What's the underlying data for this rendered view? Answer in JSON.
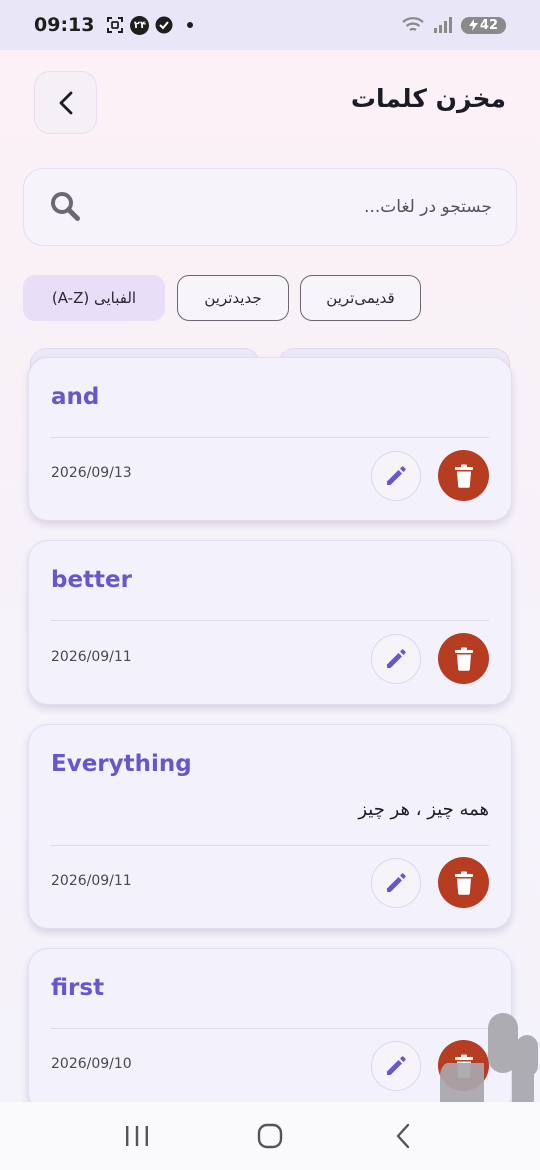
{
  "status_bar": {
    "time": "09:13",
    "badge_number": "۲۴",
    "battery_level": "42",
    "icons": [
      "screenshot-icon",
      "notification-badge-icon",
      "shield-check-icon",
      "dot-icon",
      "wifi-icon",
      "signal-icon",
      "battery-icon"
    ]
  },
  "header": {
    "title": "مخزن کلمات",
    "back_icon": "chevron-left-icon"
  },
  "search": {
    "placeholder": "جستجو در لغات...",
    "value": "",
    "icon": "search-icon"
  },
  "sort_chips": [
    {
      "label": "قدیمی‌ترین",
      "active": false
    },
    {
      "label": "جدیدترین",
      "active": false
    },
    {
      "label": "الفبایی (A-Z)",
      "active": true
    }
  ],
  "words": [
    {
      "word": "and",
      "meaning": "",
      "date": "2026/09/13"
    },
    {
      "word": "better",
      "meaning": "",
      "date": "2026/09/11"
    },
    {
      "word": "Everything",
      "meaning": "همه چیز ، هر چیز",
      "date": "2026/09/11"
    },
    {
      "word": "first",
      "meaning": "",
      "date": "2026/09/10"
    }
  ],
  "colors": {
    "accent": "#6b55cc",
    "delete": "#b63c22",
    "active_chip": "#e9def7",
    "logo_gray": "#a9a7ad"
  },
  "nav": {
    "recents_icon": "recents-icon",
    "home_icon": "home-icon",
    "back_icon": "back-icon"
  }
}
